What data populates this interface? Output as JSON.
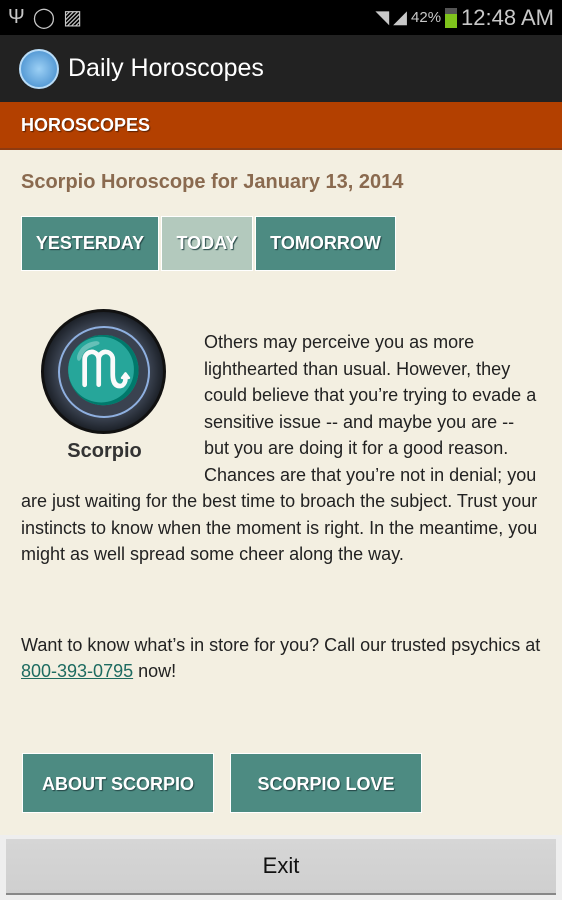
{
  "status_bar": {
    "battery": "42%",
    "time": "12:48 AM",
    "icons": [
      "usb-icon",
      "whatsapp-icon",
      "image-icon",
      "wifi-icon",
      "signal-icon",
      "battery-charging-icon"
    ]
  },
  "app": {
    "title": "Daily Horoscopes"
  },
  "section": {
    "title": "HOROSCOPES"
  },
  "page": {
    "heading": "Scorpio Horoscope for January 13, 2014"
  },
  "tabs": [
    {
      "label": "YESTERDAY"
    },
    {
      "label": "TODAY",
      "active": true
    },
    {
      "label": "TOMORROW"
    }
  ],
  "sign": {
    "glyph": "♏",
    "label": "Scorpio"
  },
  "horoscope": "Others may perceive you as more lighthearted than usual. However, they could believe that you’re trying to evade a sensitive issue -- and maybe you are -- but you are doing it for a good reason. Chances are that you’re not in denial; you are just waiting for the best time to broach the subject. Trust your instincts to know when the moment is right. In the meantime, you might as well spread some cheer along the way.",
  "promo": {
    "before": "Want to know what’s in store for you? Call our trusted psychics at ",
    "phone": "800-393-0795",
    "after": " now!"
  },
  "buttons": [
    {
      "label": "ABOUT SCORPIO"
    },
    {
      "label": "SCORPIO LOVE"
    }
  ],
  "exit_label": "Exit",
  "colors": {
    "section": "#b34000",
    "tab": "#4d8b82",
    "tab_active": "#b3c9bd",
    "background": "#f3efe1"
  }
}
